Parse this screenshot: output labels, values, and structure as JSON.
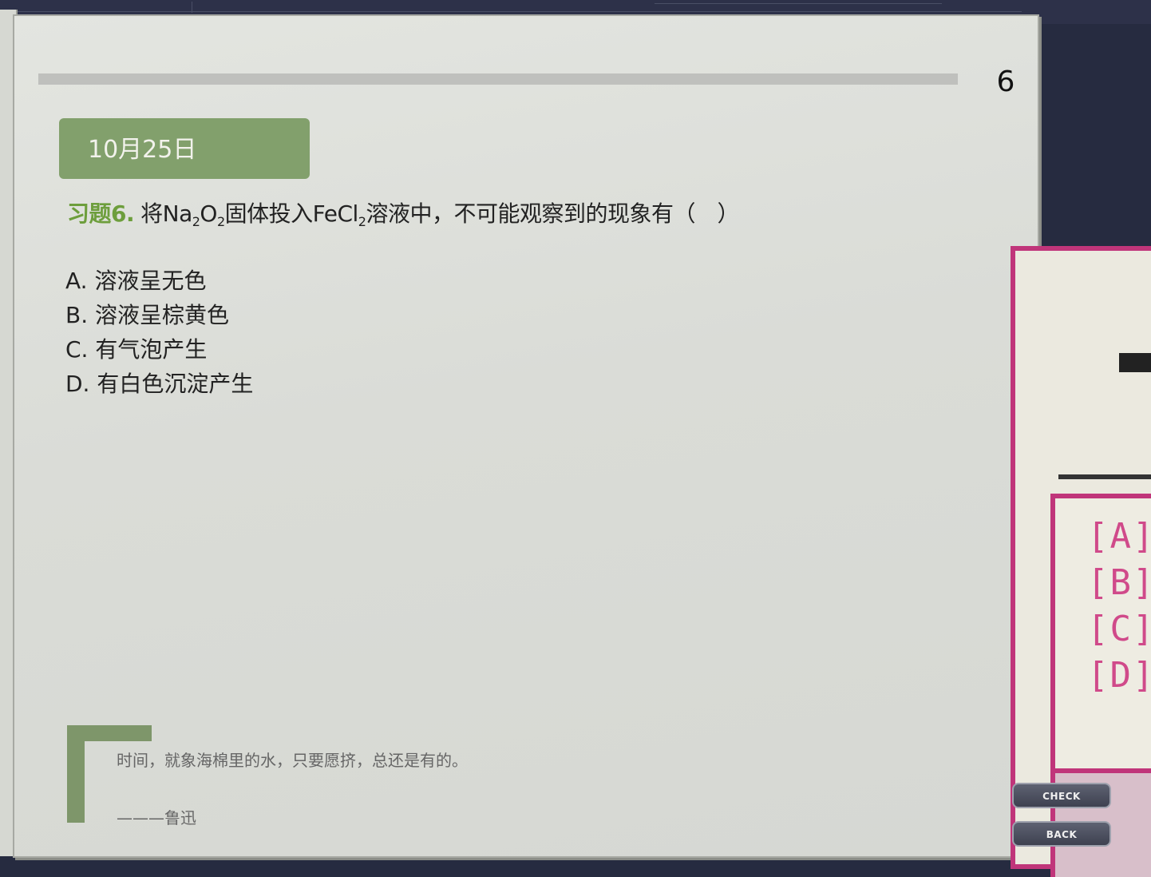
{
  "page": {
    "number": "6",
    "date": "10月25日"
  },
  "question": {
    "label": "习题6.",
    "text_1": "将Na",
    "sub_1": "2",
    "text_2": "O",
    "sub_2": "2",
    "text_3": "固体投入FeCl",
    "sub_3": "2",
    "text_4": "溶液中，不可能观察到的现象有（　）"
  },
  "options": [
    "A. 溶液呈无色",
    "B. 溶液呈棕黄色",
    "C. 有气泡产生",
    "D. 有白色沉淀产生"
  ],
  "quote": {
    "text": "时间，就象海棉里的水，只要愿挤，总还是有的。",
    "author": "———鲁迅"
  },
  "answer_panel": {
    "options": [
      "[A]",
      "[B]",
      "[C]",
      "[D]"
    ],
    "check_label": "CHECK",
    "back_label": "BACK"
  },
  "colors": {
    "accent_green": "#82a06c",
    "accent_pink": "#c0357a"
  }
}
